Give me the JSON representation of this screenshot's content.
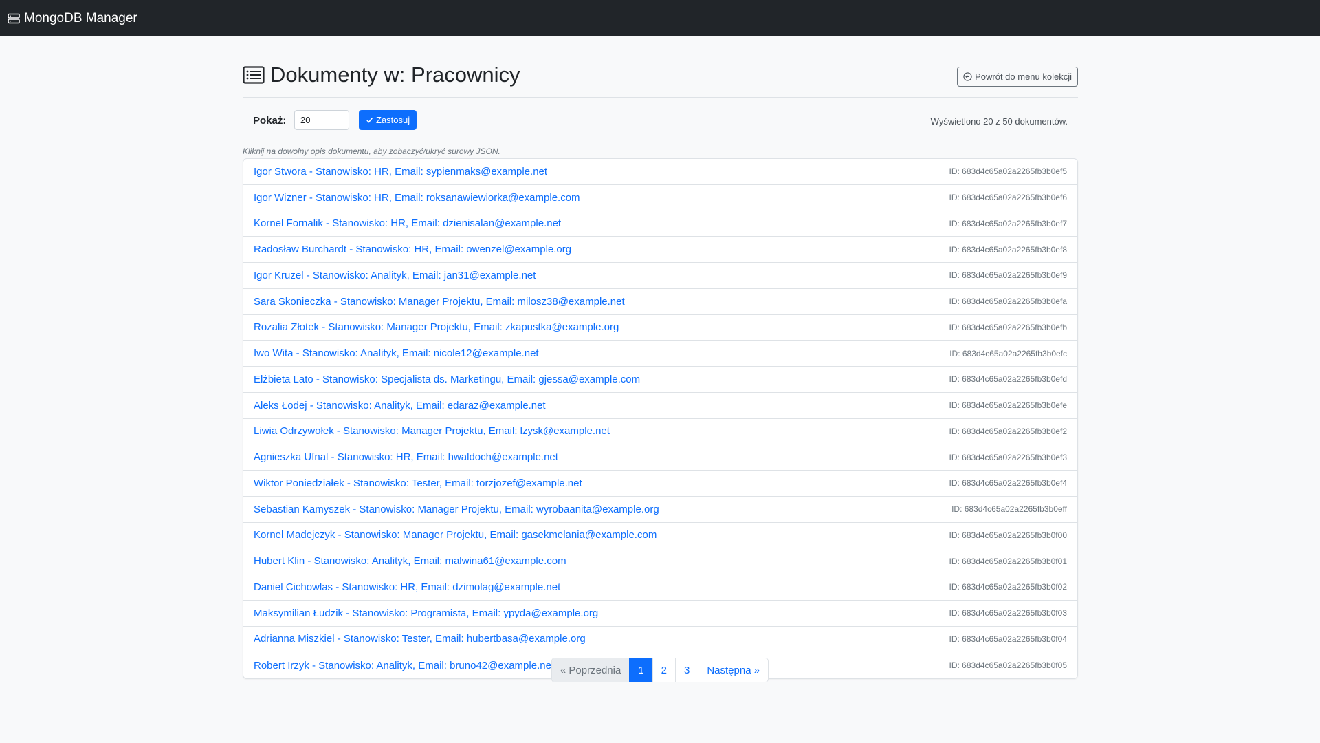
{
  "navbar": {
    "brand": "MongoDB Manager",
    "brand_icon": "server-stack-icon"
  },
  "header": {
    "title": "Dokumenty w: Pracownicy",
    "title_icon": "list-icon",
    "back_button": "Powrót do menu kolekcji",
    "back_icon": "circle-arrow-left-icon"
  },
  "controls": {
    "show_label": "Pokaż:",
    "show_value": "20",
    "apply_button": "Zastosuj",
    "apply_icon": "check-icon",
    "count_text": "Wyświetlono 20 z 50 dokumentów."
  },
  "hint": "Kliknij na dowolny opis dokumentu, aby zobaczyć/ukryć surowy JSON.",
  "documents": [
    {
      "desc": "Igor Stwora - Stanowisko: HR, Email: sypienmaks@example.net",
      "id": "ID: 683d4c65a02a2265fb3b0ef5"
    },
    {
      "desc": "Igor Wizner - Stanowisko: HR, Email: roksanawiewiorka@example.com",
      "id": "ID: 683d4c65a02a2265fb3b0ef6"
    },
    {
      "desc": "Kornel Fornalik - Stanowisko: HR, Email: dzienisalan@example.net",
      "id": "ID: 683d4c65a02a2265fb3b0ef7"
    },
    {
      "desc": "Radosław Burchardt - Stanowisko: HR, Email: owenzel@example.org",
      "id": "ID: 683d4c65a02a2265fb3b0ef8"
    },
    {
      "desc": "Igor Kruzel - Stanowisko: Analityk, Email: jan31@example.net",
      "id": "ID: 683d4c65a02a2265fb3b0ef9"
    },
    {
      "desc": "Sara Skonieczka - Stanowisko: Manager Projektu, Email: milosz38@example.net",
      "id": "ID: 683d4c65a02a2265fb3b0efa"
    },
    {
      "desc": "Rozalia Złotek - Stanowisko: Manager Projektu, Email: zkapustka@example.org",
      "id": "ID: 683d4c65a02a2265fb3b0efb"
    },
    {
      "desc": "Iwo Wita - Stanowisko: Analityk, Email: nicole12@example.net",
      "id": "ID: 683d4c65a02a2265fb3b0efc"
    },
    {
      "desc": "Elżbieta Lato - Stanowisko: Specjalista ds. Marketingu, Email: gjessa@example.com",
      "id": "ID: 683d4c65a02a2265fb3b0efd"
    },
    {
      "desc": "Aleks Łodej - Stanowisko: Analityk, Email: edaraz@example.net",
      "id": "ID: 683d4c65a02a2265fb3b0efe"
    },
    {
      "desc": "Liwia Odrzywołek - Stanowisko: Manager Projektu, Email: lzysk@example.net",
      "id": "ID: 683d4c65a02a2265fb3b0ef2"
    },
    {
      "desc": "Agnieszka Ufnal - Stanowisko: HR, Email: hwaldoch@example.net",
      "id": "ID: 683d4c65a02a2265fb3b0ef3"
    },
    {
      "desc": "Wiktor Poniedziałek - Stanowisko: Tester, Email: torzjozef@example.net",
      "id": "ID: 683d4c65a02a2265fb3b0ef4"
    },
    {
      "desc": "Sebastian Kamyszek - Stanowisko: Manager Projektu, Email: wyrobaanita@example.org",
      "id": "ID: 683d4c65a02a2265fb3b0eff"
    },
    {
      "desc": "Kornel Madejczyk - Stanowisko: Manager Projektu, Email: gasekmelania@example.com",
      "id": "ID: 683d4c65a02a2265fb3b0f00"
    },
    {
      "desc": "Hubert Klin - Stanowisko: Analityk, Email: malwina61@example.com",
      "id": "ID: 683d4c65a02a2265fb3b0f01"
    },
    {
      "desc": "Daniel Cichowlas - Stanowisko: HR, Email: dzimolag@example.net",
      "id": "ID: 683d4c65a02a2265fb3b0f02"
    },
    {
      "desc": "Maksymilian Łudzik - Stanowisko: Programista, Email: ypyda@example.org",
      "id": "ID: 683d4c65a02a2265fb3b0f03"
    },
    {
      "desc": "Adrianna Miszkiel - Stanowisko: Tester, Email: hubertbasa@example.org",
      "id": "ID: 683d4c65a02a2265fb3b0f04"
    },
    {
      "desc": "Robert Irzyk - Stanowisko: Analityk, Email: bruno42@example.net",
      "id": "ID: 683d4c65a02a2265fb3b0f05"
    }
  ],
  "pagination": {
    "prev": "« Poprzednia",
    "pages": [
      "1",
      "2",
      "3"
    ],
    "active_page": "1",
    "next": "Następna »"
  },
  "colors": {
    "navbar_bg": "#212529",
    "primary": "#0d6efd",
    "link": "#0d6efd",
    "muted": "#6c757d",
    "page_bg": "#f8f9fa"
  }
}
